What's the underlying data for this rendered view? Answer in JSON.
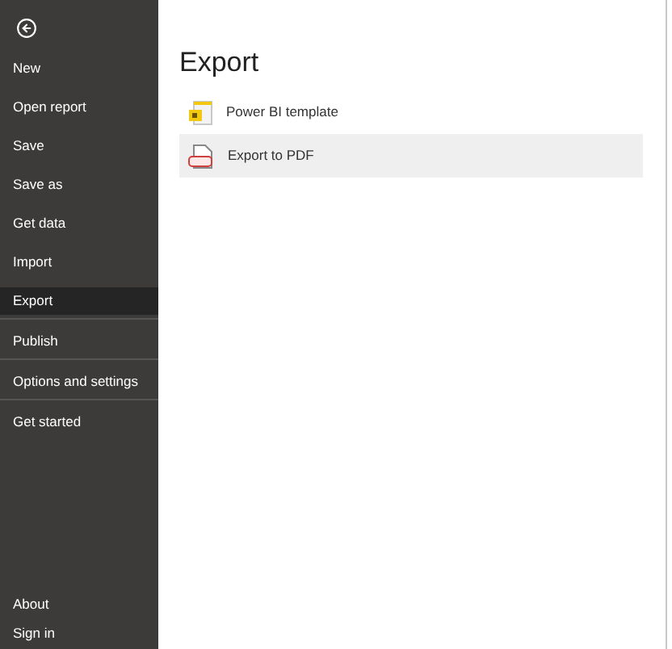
{
  "sidebar": {
    "items": [
      {
        "label": "New",
        "selected": false
      },
      {
        "label": "Open report",
        "selected": false
      },
      {
        "label": "Save",
        "selected": false
      },
      {
        "label": "Save as",
        "selected": false
      },
      {
        "label": "Get data",
        "selected": false
      },
      {
        "label": "Import",
        "selected": false
      },
      {
        "label": "Export",
        "selected": true
      },
      {
        "label": "Publish",
        "selected": false
      },
      {
        "label": "Options and settings",
        "selected": false
      },
      {
        "label": "Get started",
        "selected": false
      }
    ],
    "bottom_items": [
      {
        "label": "About",
        "selected": false
      },
      {
        "label": "Sign in",
        "selected": false
      }
    ]
  },
  "main": {
    "title": "Export",
    "options": [
      {
        "kind": "template",
        "label": "Power BI template",
        "selected": false
      },
      {
        "kind": "pdf",
        "label": "Export to PDF",
        "selected": true
      }
    ]
  }
}
